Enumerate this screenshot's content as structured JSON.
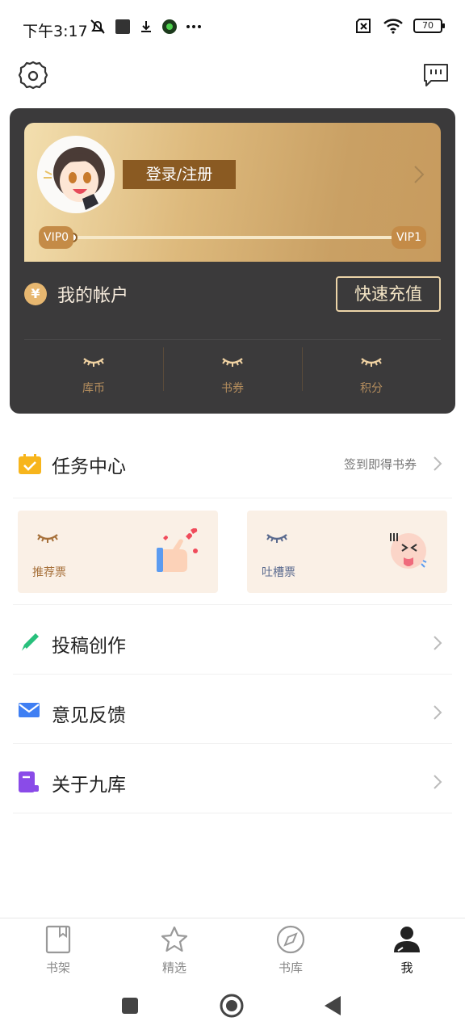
{
  "status": {
    "time": "下午3:17",
    "battery": "70"
  },
  "account": {
    "login_label": "登录/注册",
    "vip_current": "VIP0",
    "vip_next": "VIP1",
    "yuan_symbol": "¥",
    "my_account_label": "我的帐户",
    "recharge_label": "快速充值",
    "stats": [
      {
        "label": "库币"
      },
      {
        "label": "书券"
      },
      {
        "label": "积分"
      }
    ]
  },
  "task_center": {
    "title": "任务中心",
    "hint": "签到即得书券"
  },
  "tickets": {
    "recommend_label": "推荐票",
    "complain_label": "吐槽票"
  },
  "menu": {
    "submit_label": "投稿创作",
    "feedback_label": "意见反馈",
    "about_label": "关于九库"
  },
  "nav": {
    "bookshelf": "书架",
    "featured": "精选",
    "library": "书库",
    "me": "我"
  },
  "colors": {
    "card_bg": "#3b3a3b",
    "gold_accent": "#8a5a22",
    "ticket_bg": "#faf0e6"
  }
}
